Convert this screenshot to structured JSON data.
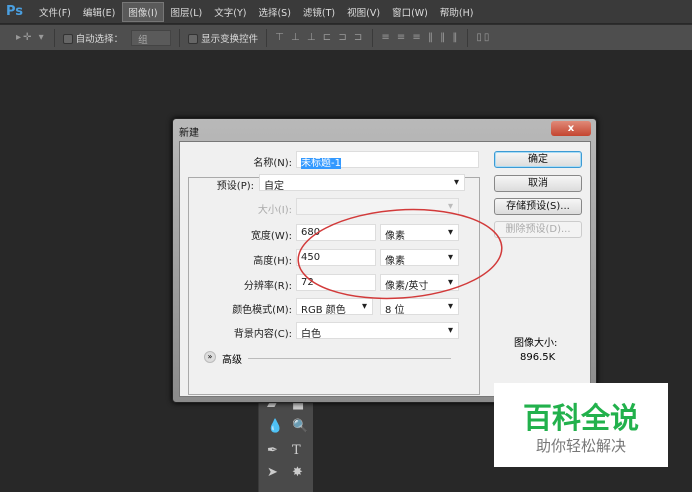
{
  "app": {
    "logo": "Ps"
  },
  "menu": [
    "文件(F)",
    "编辑(E)",
    "图像(I)",
    "图层(L)",
    "文字(Y)",
    "选择(S)",
    "滤镜(T)",
    "视图(V)",
    "窗口(W)",
    "帮助(H)"
  ],
  "options": {
    "auto_select_label": "自动选择：",
    "auto_select_value": "组",
    "show_transform_label": "显示变换控件"
  },
  "dialog": {
    "title": "新建",
    "close": "x",
    "name_label": "名称(N):",
    "name_value": "未标题-1",
    "preset_label": "预设(P):",
    "preset_value": "自定",
    "size_label": "大小(I):",
    "width_label": "宽度(W):",
    "width_value": "680",
    "width_unit": "像素",
    "height_label": "高度(H):",
    "height_value": "450",
    "height_unit": "像素",
    "res_label": "分辨率(R):",
    "res_value": "72",
    "res_unit": "像素/英寸",
    "mode_label": "颜色模式(M):",
    "mode_value": "RGB 颜色",
    "depth_value": "8 位",
    "bg_label": "背景内容(C):",
    "bg_value": "白色",
    "advanced": "高级",
    "buttons": {
      "ok": "确定",
      "cancel": "取消",
      "save": "存储预设(S)...",
      "delete": "删除预设(D)..."
    },
    "image_size_label": "图像大小:",
    "image_size_value": "896.5K"
  },
  "watermark": {
    "title": "百科全说",
    "subtitle": "助你轻松解决"
  },
  "colors": {
    "annotation": "#d23a3a",
    "watermark": "#22b14c"
  }
}
